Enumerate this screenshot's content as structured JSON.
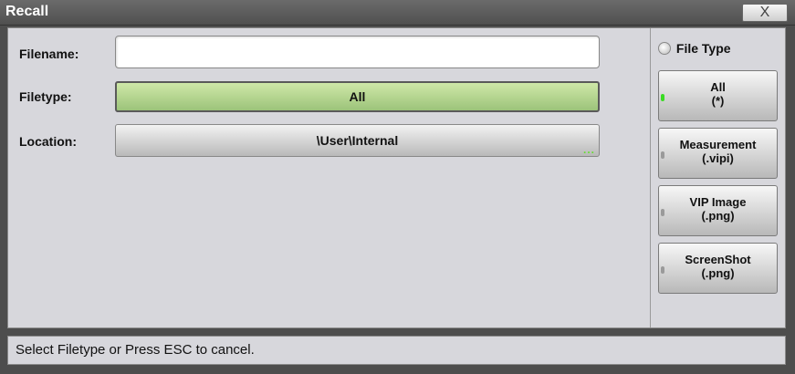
{
  "window": {
    "title": "Recall",
    "close_label": "X"
  },
  "form": {
    "filename_label": "Filename:",
    "filename_value": "",
    "filetype_label": "Filetype:",
    "filetype_value": "All",
    "location_label": "Location:",
    "location_value": "\\User\\Internal",
    "location_more": "..."
  },
  "file_type_panel": {
    "header": "File Type",
    "options": [
      {
        "line1": "All",
        "line2": "(*)",
        "selected": true
      },
      {
        "line1": "Measurement",
        "line2": "(.vipi)",
        "selected": false
      },
      {
        "line1": "VIP Image",
        "line2": "(.png)",
        "selected": false
      },
      {
        "line1": "ScreenShot",
        "line2": "(.png)",
        "selected": false
      }
    ]
  },
  "status": {
    "text": "Select Filetype or Press ESC to cancel."
  },
  "colors": {
    "selected_green": "#9cc37a",
    "led_on": "#3adb24",
    "led_off": "#9a9a9a"
  }
}
